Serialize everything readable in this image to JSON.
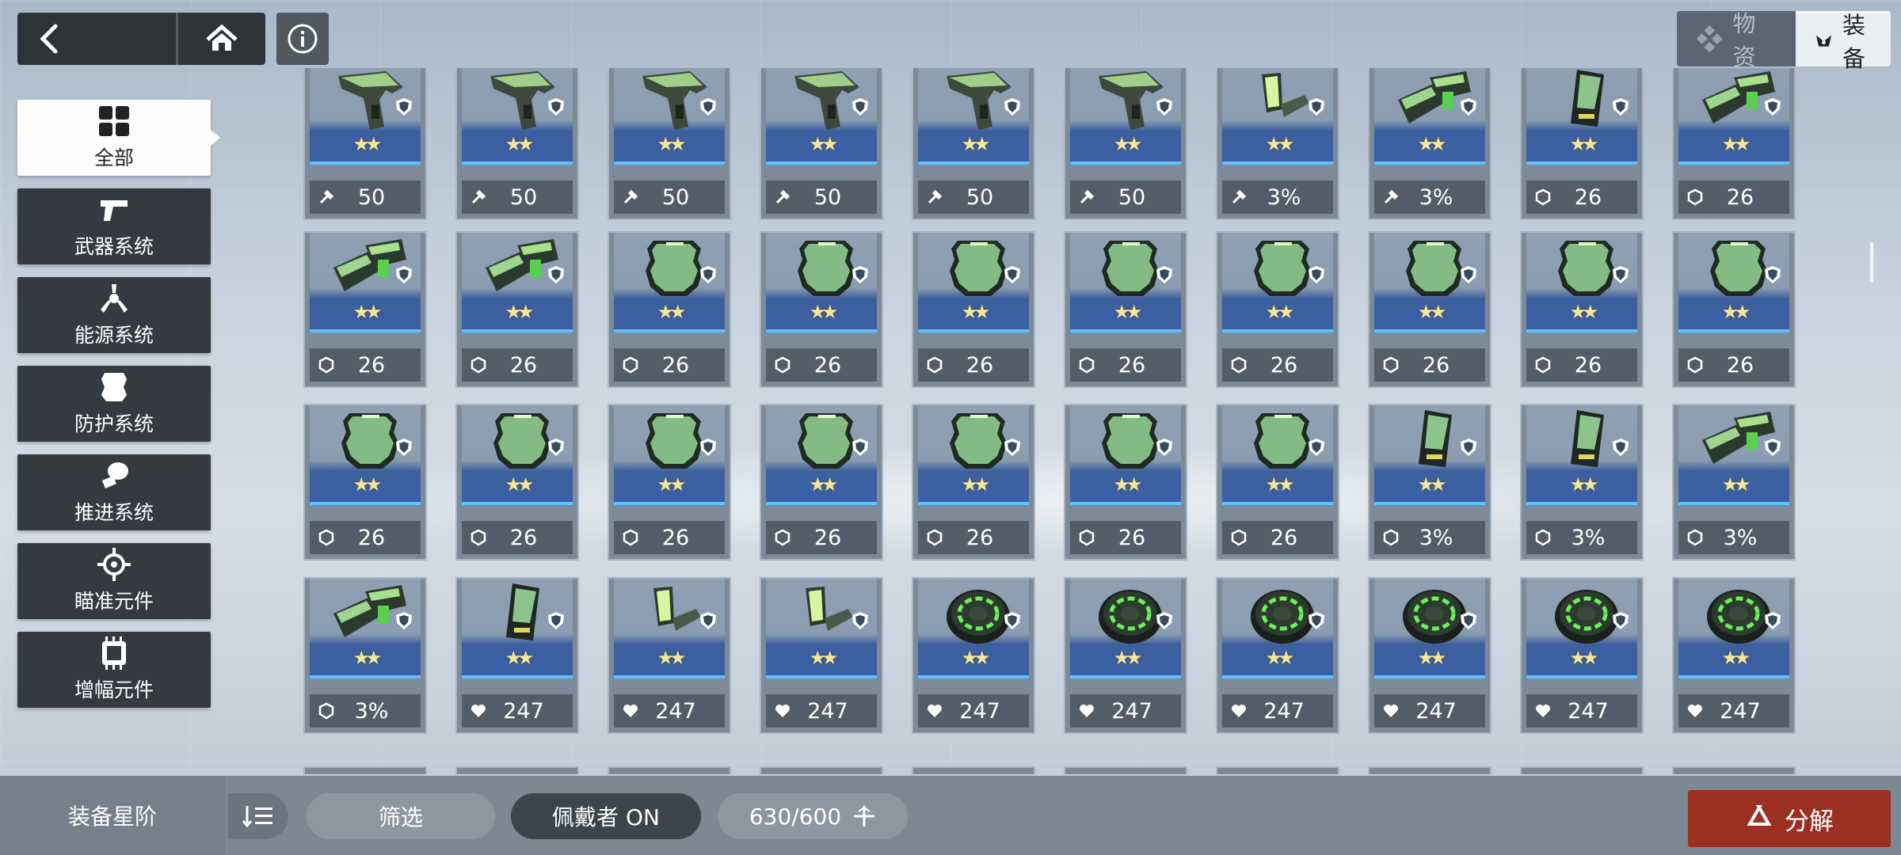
{
  "top_tabs": [
    {
      "label": "物资",
      "icon": "materials-icon"
    },
    {
      "label": "装备",
      "icon": "equipment-icon"
    }
  ],
  "sidebar": {
    "items": [
      {
        "label": "全部",
        "icon": "grid-all-icon",
        "active": true
      },
      {
        "label": "武器系统",
        "icon": "pistol-icon",
        "active": false
      },
      {
        "label": "能源系统",
        "icon": "energy-icon",
        "active": false
      },
      {
        "label": "防护系统",
        "icon": "armor-icon",
        "active": false
      },
      {
        "label": "推进系统",
        "icon": "thruster-icon",
        "active": false
      },
      {
        "label": "瞄准元件",
        "icon": "crosshair-icon",
        "active": false
      },
      {
        "label": "增幅元件",
        "icon": "chip-icon",
        "active": false
      }
    ]
  },
  "grid": {
    "rows": [
      [
        {
          "item": "gun",
          "stat_icon": "wrench-icon",
          "value": "50"
        },
        {
          "item": "gun",
          "stat_icon": "wrench-icon",
          "value": "50"
        },
        {
          "item": "gun",
          "stat_icon": "wrench-icon",
          "value": "50"
        },
        {
          "item": "gun",
          "stat_icon": "wrench-icon",
          "value": "50"
        },
        {
          "item": "gun",
          "stat_icon": "wrench-icon",
          "value": "50"
        },
        {
          "item": "gun",
          "stat_icon": "wrench-icon",
          "value": "50"
        },
        {
          "item": "scope",
          "stat_icon": "wrench-icon",
          "value": "3%"
        },
        {
          "item": "thruster",
          "stat_icon": "wrench-icon",
          "value": "3%"
        },
        {
          "item": "panel",
          "stat_icon": "hex-shield-icon",
          "value": "26"
        },
        {
          "item": "thruster",
          "stat_icon": "hex-shield-icon",
          "value": "26"
        }
      ],
      [
        {
          "item": "thruster",
          "stat_icon": "hex-shield-icon",
          "value": "26"
        },
        {
          "item": "thruster",
          "stat_icon": "hex-shield-icon",
          "value": "26"
        },
        {
          "item": "armor",
          "stat_icon": "hex-shield-icon",
          "value": "26"
        },
        {
          "item": "armor",
          "stat_icon": "hex-shield-icon",
          "value": "26"
        },
        {
          "item": "armor",
          "stat_icon": "hex-shield-icon",
          "value": "26"
        },
        {
          "item": "armor",
          "stat_icon": "hex-shield-icon",
          "value": "26"
        },
        {
          "item": "armor",
          "stat_icon": "hex-shield-icon",
          "value": "26"
        },
        {
          "item": "armor",
          "stat_icon": "hex-shield-icon",
          "value": "26"
        },
        {
          "item": "armor",
          "stat_icon": "hex-shield-icon",
          "value": "26"
        },
        {
          "item": "armor",
          "stat_icon": "hex-shield-icon",
          "value": "26"
        }
      ],
      [
        {
          "item": "armor",
          "stat_icon": "hex-shield-icon",
          "value": "26"
        },
        {
          "item": "armor",
          "stat_icon": "hex-shield-icon",
          "value": "26"
        },
        {
          "item": "armor",
          "stat_icon": "hex-shield-icon",
          "value": "26"
        },
        {
          "item": "armor",
          "stat_icon": "hex-shield-icon",
          "value": "26"
        },
        {
          "item": "armor",
          "stat_icon": "hex-shield-icon",
          "value": "26"
        },
        {
          "item": "armor",
          "stat_icon": "hex-shield-icon",
          "value": "26"
        },
        {
          "item": "armor",
          "stat_icon": "hex-shield-icon",
          "value": "26"
        },
        {
          "item": "panel",
          "stat_icon": "hex-shield-icon",
          "value": "3%"
        },
        {
          "item": "panel",
          "stat_icon": "hex-shield-icon",
          "value": "3%"
        },
        {
          "item": "thruster",
          "stat_icon": "hex-shield-icon",
          "value": "3%"
        }
      ],
      [
        {
          "item": "thruster",
          "stat_icon": "hex-shield-icon",
          "value": "3%"
        },
        {
          "item": "panel",
          "stat_icon": "heart-icon",
          "value": "247"
        },
        {
          "item": "scope",
          "stat_icon": "heart-icon",
          "value": "247"
        },
        {
          "item": "scope",
          "stat_icon": "heart-icon",
          "value": "247"
        },
        {
          "item": "ring",
          "stat_icon": "heart-icon",
          "value": "247"
        },
        {
          "item": "ring",
          "stat_icon": "heart-icon",
          "value": "247"
        },
        {
          "item": "ring",
          "stat_icon": "heart-icon",
          "value": "247"
        },
        {
          "item": "ring",
          "stat_icon": "heart-icon",
          "value": "247"
        },
        {
          "item": "ring",
          "stat_icon": "heart-icon",
          "value": "247"
        },
        {
          "item": "ring",
          "stat_icon": "heart-icon",
          "value": "247"
        }
      ]
    ],
    "stars": "★★"
  },
  "bottom": {
    "sort_label": "装备星阶",
    "filter_label": "筛选",
    "wearer_label": "佩戴者 ON",
    "capacity": "630/600",
    "decompose_label": "分解"
  },
  "colors": {
    "accent_red": "#9b2f22",
    "card_blue": "#3a5fa6",
    "item_green": "#7fbf7f"
  }
}
